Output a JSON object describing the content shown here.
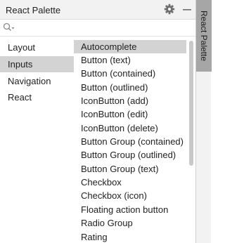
{
  "window": {
    "title": "React Palette"
  },
  "toolbar": {
    "settings_icon": "gear-icon",
    "minimize_icon": "minimize-icon"
  },
  "search": {
    "icon": "search-icon",
    "value": ""
  },
  "categories": [
    {
      "label": "Layout",
      "selected": false
    },
    {
      "label": "Inputs",
      "selected": true
    },
    {
      "label": "Navigation",
      "selected": false
    },
    {
      "label": "React",
      "selected": false
    }
  ],
  "items": [
    {
      "label": "Autocomplete",
      "selected": true
    },
    {
      "label": "Button (text)",
      "selected": false
    },
    {
      "label": "Button (contained)",
      "selected": false
    },
    {
      "label": "Button (outlined)",
      "selected": false
    },
    {
      "label": "IconButton (add)",
      "selected": false
    },
    {
      "label": "IconButton (edit)",
      "selected": false
    },
    {
      "label": "IconButton (delete)",
      "selected": false
    },
    {
      "label": "Button Group (contained)",
      "selected": false
    },
    {
      "label": "Button Group (outlined)",
      "selected": false
    },
    {
      "label": "Button Group (text)",
      "selected": false
    },
    {
      "label": "Checkbox",
      "selected": false
    },
    {
      "label": "Checkbox (icon)",
      "selected": false
    },
    {
      "label": "Floating action button",
      "selected": false
    },
    {
      "label": "Radio Group",
      "selected": false
    },
    {
      "label": "Rating",
      "selected": false
    }
  ],
  "side_tab": {
    "label": "React Palette"
  },
  "colors": {
    "selection": "#d3d3d3",
    "side_tab": "#a6a6a6",
    "header": "#f2f2f2"
  }
}
